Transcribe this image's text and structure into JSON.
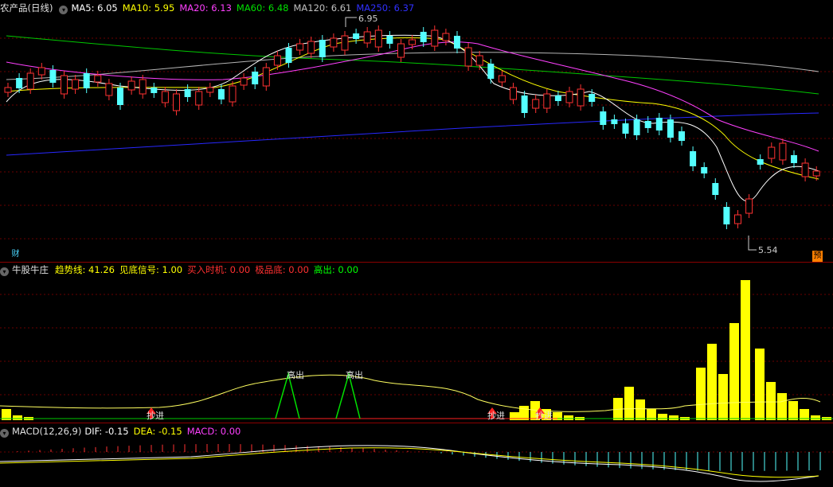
{
  "main_panel": {
    "title": "农产品(日线)",
    "indicators": [
      {
        "label": "MA5",
        "value": "6.05",
        "color": "#ffffff"
      },
      {
        "label": "MA10",
        "value": "5.95",
        "color": "#ffff00"
      },
      {
        "label": "MA20",
        "value": "6.13",
        "color": "#ff40ff"
      },
      {
        "label": "MA60",
        "value": "6.48",
        "color": "#00e000"
      },
      {
        "label": "MA120",
        "value": "6.61",
        "color": "#c0c0c0"
      },
      {
        "label": "MA250",
        "value": "6.37",
        "color": "#3030ff"
      }
    ],
    "high_marker": "6.95",
    "low_marker": "5.54",
    "badge_left": "财",
    "badge_right": "预",
    "candle_colors": {
      "up": "#ff3232",
      "down": "#54ffff"
    }
  },
  "signal_panel": {
    "title": "牛股牛庄",
    "indicators": [
      {
        "label": "趋势线",
        "value": "41.26",
        "color": "#ffff00"
      },
      {
        "label": "见底信号",
        "value": "1.00",
        "color": "#ffff00"
      },
      {
        "label": "买入时机",
        "value": "0.00",
        "color": "#ff3030"
      },
      {
        "label": "极品底",
        "value": "0.00",
        "color": "#ff3030"
      },
      {
        "label": "高出",
        "value": "0.00",
        "color": "#00ff00"
      }
    ],
    "labels": {
      "buy": "抄进",
      "sell": "高出"
    }
  },
  "macd_panel": {
    "title": "MACD(12,26,9)",
    "indicators": [
      {
        "label": "DIF",
        "value": "-0.15",
        "color": "#ffffff"
      },
      {
        "label": "DEA",
        "value": "-0.15",
        "color": "#ffff00"
      },
      {
        "label": "MACD",
        "value": "0.00",
        "color": "#ff40ff"
      }
    ]
  }
}
